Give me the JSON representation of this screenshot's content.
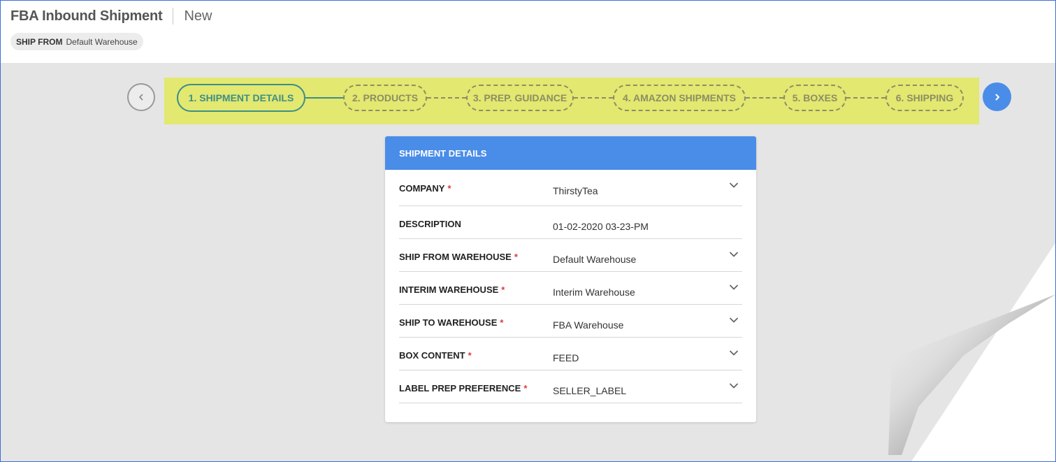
{
  "header": {
    "title": "FBA Inbound Shipment",
    "record": "New",
    "chip": {
      "label": "SHIP FROM",
      "value": "Default Warehouse"
    }
  },
  "stepper": {
    "steps": [
      {
        "label": "1. SHIPMENT DETAILS",
        "state": "active"
      },
      {
        "label": "2. PRODUCTS",
        "state": "pending"
      },
      {
        "label": "3. PREP. GUIDANCE",
        "state": "pending"
      },
      {
        "label": "4. AMAZON SHIPMENTS",
        "state": "pending"
      },
      {
        "label": "5. BOXES",
        "state": "pending"
      },
      {
        "label": "6. SHIPPING",
        "state": "pending"
      }
    ],
    "prev_icon": "chevron-left-icon",
    "next_icon": "chevron-right-icon"
  },
  "card": {
    "title": "SHIPMENT DETAILS",
    "fields": [
      {
        "label": "COMPANY",
        "required": "*",
        "value": "ThirstyTea",
        "dropdown": true
      },
      {
        "label": "DESCRIPTION",
        "required": "",
        "value": "01-02-2020 03-23-PM",
        "dropdown": false
      },
      {
        "label": "SHIP FROM WAREHOUSE",
        "required": "*",
        "value": "Default Warehouse",
        "dropdown": true
      },
      {
        "label": "INTERIM WAREHOUSE",
        "required": "*",
        "value": "Interim Warehouse",
        "dropdown": true
      },
      {
        "label": "SHIP TO WAREHOUSE",
        "required": "*",
        "value": "FBA Warehouse",
        "dropdown": true
      },
      {
        "label": "BOX CONTENT",
        "required": "*",
        "value": "FEED",
        "dropdown": true
      },
      {
        "label": "LABEL PREP PREFERENCE",
        "required": "*",
        "value": "SELLER_LABEL",
        "dropdown": true
      }
    ]
  },
  "colors": {
    "accent": "#4a8de8",
    "stepper_bg": "#e2e870",
    "active_step": "#3e8e85",
    "pending_step": "#8d8d63",
    "required": "#e03b3b"
  }
}
